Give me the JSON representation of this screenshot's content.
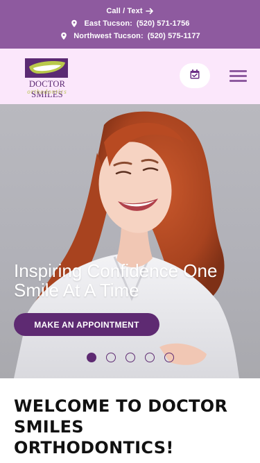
{
  "topbar": {
    "call_text": "Call / Text",
    "locations": [
      {
        "name": "East Tucson:",
        "phone": "(520) 571-1756"
      },
      {
        "name": "Northwest Tucson:",
        "phone": "(520) 575-1177"
      }
    ],
    "icons": {
      "location": "map-pin-icon",
      "arrow": "arrow-right-icon"
    },
    "color": "#8e5a9f"
  },
  "header": {
    "logo_name": "DOCTOR SMILES",
    "logo_sub": "orthodontics",
    "icons": {
      "calendar": "calendar-check-icon",
      "menu": "hamburger-menu-icon"
    },
    "background": "#fbe7fb"
  },
  "hero": {
    "headline": "Inspiring Confidence One Smile At A Time",
    "cta_label": "MAKE AN APPOINTMENT",
    "slides_total": 5,
    "slide_active": 1,
    "accent": "#5e2a72"
  },
  "welcome": {
    "title": "WELCOME TO DOCTOR SMILES ORTHODONTICS!"
  }
}
